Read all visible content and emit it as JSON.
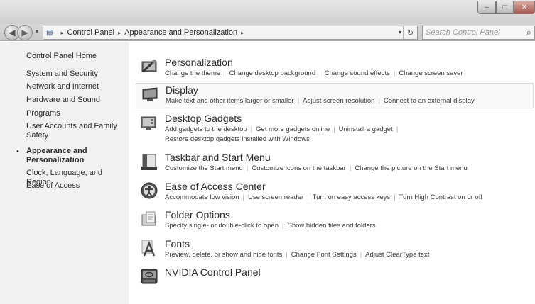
{
  "window": {
    "min_glyph": "–",
    "max_glyph": "□",
    "close_glyph": "✕"
  },
  "nav": {
    "back_glyph": "◀",
    "forward_glyph": "▶",
    "dropdown_glyph": "▼"
  },
  "address": {
    "crumbs": [
      "Control Panel",
      "Appearance and Personalization"
    ],
    "separator": "▸",
    "dropdown_glyph": "▾",
    "refresh_glyph": "↻"
  },
  "search": {
    "placeholder": "Search Control Panel",
    "icon": "search-icon"
  },
  "sidebar": {
    "bullet": "•",
    "items": [
      {
        "label": "Control Panel Home"
      },
      {
        "label": "System and Security"
      },
      {
        "label": "Network and Internet"
      },
      {
        "label": "Hardware and Sound"
      },
      {
        "label": "Programs"
      },
      {
        "label": "User Accounts and Family Safety"
      },
      {
        "label": "Appearance and Personalization",
        "current": true
      },
      {
        "label": "Clock, Language, and Region"
      },
      {
        "label": "Ease of Access"
      }
    ]
  },
  "categories": [
    {
      "title": "Personalization",
      "icon": "personalization-icon",
      "links": [
        "Change the theme",
        "Change desktop background",
        "Change sound effects",
        "Change screen saver"
      ]
    },
    {
      "title": "Display",
      "icon": "display-icon",
      "links": [
        "Make text and other items larger or smaller",
        "Adjust screen resolution",
        "Connect to an external display"
      ]
    },
    {
      "title": "Desktop Gadgets",
      "icon": "gadgets-icon",
      "links": [
        "Add gadgets to the desktop",
        "Get more gadgets online",
        "Uninstall a gadget",
        "Restore desktop gadgets installed with Windows"
      ]
    },
    {
      "title": "Taskbar and Start Menu",
      "icon": "taskbar-icon",
      "links": [
        "Customize the Start menu",
        "Customize icons on the taskbar",
        "Change the picture on the Start menu"
      ]
    },
    {
      "title": "Ease of Access Center",
      "icon": "ease-of-access-icon",
      "links": [
        "Accommodate low vision",
        "Use screen reader",
        "Turn on easy access keys",
        "Turn High Contrast on or off"
      ]
    },
    {
      "title": "Folder Options",
      "icon": "folder-options-icon",
      "links": [
        "Specify single- or double-click to open",
        "Show hidden files and folders"
      ]
    },
    {
      "title": "Fonts",
      "icon": "fonts-icon",
      "links": [
        "Preview, delete, or show and hide fonts",
        "Change Font Settings",
        "Adjust ClearType text"
      ]
    },
    {
      "title": "NVIDIA Control Panel",
      "icon": "nvidia-icon",
      "links": []
    }
  ]
}
